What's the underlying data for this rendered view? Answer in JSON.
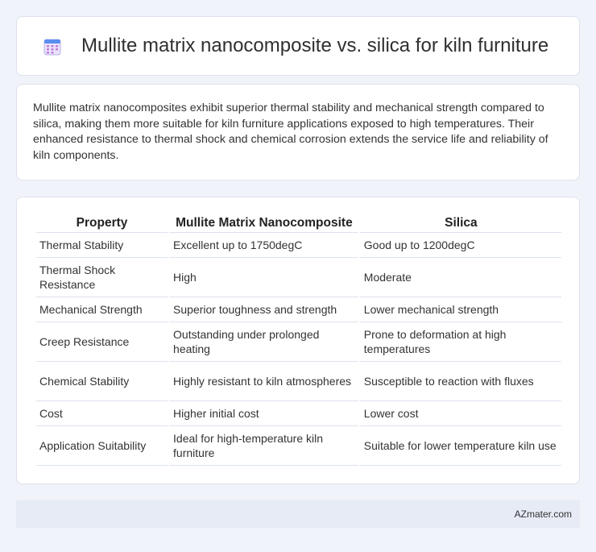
{
  "header": {
    "title": "Mullite matrix nanocomposite vs. silica for kiln furniture",
    "icon": "calendar-icon"
  },
  "summary": {
    "text": "Mullite matrix nanocomposites exhibit superior thermal stability and mechanical strength compared to silica, making them more suitable for kiln furniture applications exposed to high temperatures. Their enhanced resistance to thermal shock and chemical corrosion extends the service life and reliability of kiln components."
  },
  "table": {
    "headers": [
      "Property",
      "Mullite Matrix Nanocomposite",
      "Silica"
    ],
    "rows": [
      [
        "Thermal Stability",
        "Excellent up to 1750degC",
        "Good up to 1200degC"
      ],
      [
        "Thermal Shock Resistance",
        "High",
        "Moderate"
      ],
      [
        "Mechanical Strength",
        "Superior toughness and strength",
        "Lower mechanical strength"
      ],
      [
        "Creep Resistance",
        "Outstanding under prolonged heating",
        "Prone to deformation at high temperatures"
      ],
      [
        "Chemical Stability",
        "Highly resistant to kiln atmospheres",
        "Susceptible to reaction with fluxes"
      ],
      [
        "Cost",
        "Higher initial cost",
        "Lower cost"
      ],
      [
        "Application Suitability",
        "Ideal for high-temperature kiln furniture",
        "Suitable for lower temperature kiln use"
      ]
    ]
  },
  "footer": {
    "brand": "AZmater.com"
  }
}
